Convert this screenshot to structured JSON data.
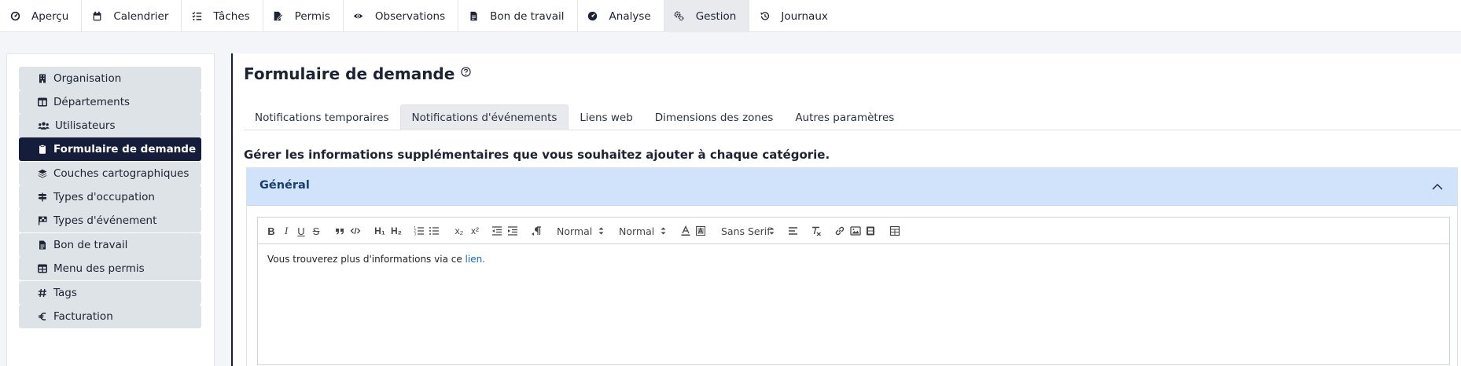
{
  "topnav": {
    "items": [
      {
        "label": "Aperçu",
        "icon": "gauge-icon",
        "active": false
      },
      {
        "label": "Calendrier",
        "icon": "calendar-icon",
        "active": false
      },
      {
        "label": "Tâches",
        "icon": "tasks-icon",
        "active": false
      },
      {
        "label": "Permis",
        "icon": "permit-icon",
        "active": false
      },
      {
        "label": "Observations",
        "icon": "eye-icon",
        "active": false
      },
      {
        "label": "Bon de travail",
        "icon": "document-icon",
        "active": false
      },
      {
        "label": "Analyse",
        "icon": "chart-dial-icon",
        "active": false
      },
      {
        "label": "Gestion",
        "icon": "gears-icon",
        "active": true
      },
      {
        "label": "Journaux",
        "icon": "history-icon",
        "active": false
      }
    ]
  },
  "sidebar": {
    "items": [
      {
        "label": "Organisation",
        "icon": "building-icon",
        "active": false
      },
      {
        "label": "Départements",
        "icon": "table-columns-icon",
        "active": false
      },
      {
        "label": "Utilisateurs",
        "icon": "users-icon",
        "active": false
      },
      {
        "label": "Formulaire de demande",
        "icon": "clipboard-icon",
        "active": true
      },
      {
        "label": "Couches cartographiques",
        "icon": "layers-icon",
        "active": false
      },
      {
        "label": "Types d'occupation",
        "icon": "sign-icon",
        "active": false
      },
      {
        "label": "Types d'événement",
        "icon": "flag-icon",
        "active": false
      },
      {
        "label": "Bon de travail",
        "icon": "document-icon",
        "active": false
      },
      {
        "label": "Menu des permis",
        "icon": "table-icon",
        "active": false
      },
      {
        "label": "Tags",
        "icon": "hash-icon",
        "active": false
      },
      {
        "label": "Facturation",
        "icon": "euro-icon",
        "active": false
      }
    ]
  },
  "main": {
    "title": "Formulaire de demande",
    "tabs": [
      {
        "label": "Notifications temporaires",
        "active": false
      },
      {
        "label": "Notifications d'événements",
        "active": true
      },
      {
        "label": "Liens web",
        "active": false
      },
      {
        "label": "Dimensions des zones",
        "active": false
      },
      {
        "label": "Autres paramètres",
        "active": false
      }
    ],
    "section_heading": "Gérer les informations supplémentaires que vous souhaitez ajouter à chaque catégorie.",
    "accordion": {
      "title": "Général",
      "expanded": true
    },
    "editor": {
      "toolbar": {
        "bold": "B",
        "italic": "I",
        "underline": "U",
        "strike": "S",
        "h1": "H₁",
        "h2": "H₂",
        "subscript": "x₂",
        "superscript": "x²",
        "size_picker": "Normal",
        "header_picker": "Normal",
        "font_picker": "Sans Serif"
      },
      "content_text": "Vous trouverez plus d'informations via ce ",
      "content_link": "lien."
    }
  },
  "colors": {
    "accent_dark": "#151d3a",
    "accordion_header": "#d1e2fb",
    "link": "#1565c0"
  }
}
